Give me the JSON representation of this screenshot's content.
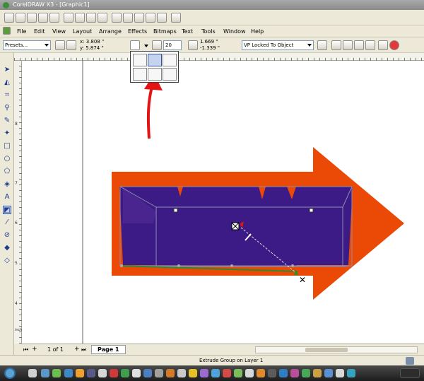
{
  "window": {
    "title": "CorelDRAW X3 - [Graphic1]"
  },
  "menu": [
    "File",
    "Edit",
    "View",
    "Layout",
    "Arrange",
    "Effects",
    "Bitmaps",
    "Text",
    "Tools",
    "Window",
    "Help"
  ],
  "property_bar": {
    "presets_value": "Presets...",
    "x_value": "x: 3.808 \"",
    "y_value": "y: 5.874 \"",
    "depth_value": "20",
    "vp_x_value": "1.669 \"",
    "vp_y_value": "-1.339 \"",
    "vp_mode_value": "VP Locked To Object"
  },
  "ruler": {
    "v_labels": [
      "8",
      "7",
      "6",
      "5",
      "4"
    ],
    "units": "inches"
  },
  "page_nav": {
    "counter": "1 of 1",
    "page_tab": "Page 1"
  },
  "status": {
    "text": "Extrude Group on Layer 1"
  },
  "colors": {
    "arrow": "#ea4a06",
    "extrude": "#3d1b86",
    "pointer": "#e51414"
  }
}
